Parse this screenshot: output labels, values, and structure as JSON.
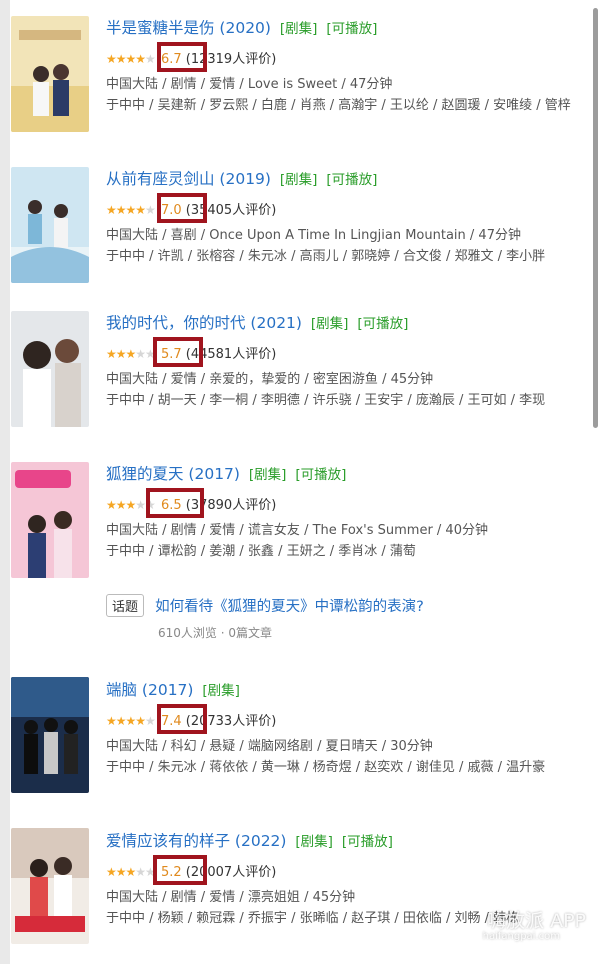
{
  "items": [
    {
      "title": "半是蜜糖半是伤 (2020)",
      "tags": [
        "[剧集]",
        "[可播放]"
      ],
      "stars": 3.5,
      "score": "6.7",
      "reviews": "(12319人评价)",
      "meta": "中国大陆 / 剧情 / 爱情 / Love is Sweet / 47分钟",
      "cast": "于中中 / 吴建新 / 罗云熙 / 白鹿 / 肖燕 / 高瀚宇 / 王以纶 / 赵圆瑗 / 安唯绫 / 管梓"
    },
    {
      "title": "从前有座灵剑山 (2019)",
      "tags": [
        "[剧集]",
        "[可播放]"
      ],
      "stars": 3.5,
      "score": "7.0",
      "reviews": "(35405人评价)",
      "meta": "中国大陆 / 喜剧 / Once Upon A Time In Lingjian Mountain / 47分钟",
      "cast": "于中中 / 许凯 / 张榕容 / 朱元冰 / 高雨儿 / 郭晓婷 / 合文俊 / 郑雅文 / 李小胖"
    },
    {
      "title": "我的时代，你的时代 (2021)",
      "tags": [
        "[剧集]",
        "[可播放]"
      ],
      "stars": 3,
      "score": "5.7",
      "reviews": "(44581人评价)",
      "meta": "中国大陆 / 爱情 / 亲爱的，挚爱的 / 密室困游鱼 / 45分钟",
      "cast": "于中中 / 胡一天 / 李一桐 / 李明德 / 许乐骁 / 王安宇 / 庞瀚辰 / 王可如 / 李现"
    },
    {
      "title": "狐狸的夏天 (2017)",
      "tags": [
        "[剧集]",
        "[可播放]"
      ],
      "stars": 3,
      "score": "6.5",
      "reviews": "(37890人评价)",
      "meta": "中国大陆 / 剧情 / 爱情 / 谎言女友 / The Fox's Summer / 40分钟",
      "cast": "于中中 / 谭松韵 / 姜潮 / 张鑫 / 王妍之 / 季肖冰 / 蒲萄"
    },
    {
      "title": "端脑 (2017)",
      "tags": [
        "[剧集]"
      ],
      "stars": 3.5,
      "score": "7.4",
      "reviews": "(20733人评价)",
      "meta": "中国大陆 / 科幻 / 悬疑 / 端脑网络剧 / 夏日晴天 / 30分钟",
      "cast": "于中中 / 朱元冰 / 蒋依依 / 黄一琳 / 杨奇煜 / 赵奕欢 / 谢佳见 / 戚薇 / 温升豪"
    },
    {
      "title": "爱情应该有的样子 (2022)",
      "tags": [
        "[剧集]",
        "[可播放]"
      ],
      "stars": 2.5,
      "score": "5.2",
      "reviews": "(20007人评价)",
      "meta": "中国大陆 / 剧情 / 爱情 / 漂亮姐姐 / 45分钟",
      "cast": "于中中 / 杨颖 / 赖冠霖 / 乔振宇 / 张晞临 / 赵子琪 / 田依临 / 刘畅 / 韩栋"
    }
  ],
  "topic": {
    "tag": "话题",
    "title": "如何看待《狐狸的夏天》中谭松韵的表演?",
    "stats": "610人浏览 · 0篇文章"
  },
  "watermark": {
    "text": "嗨放派 APP",
    "sub": "haifangpai.com"
  },
  "colors": {
    "title": "#2770c4",
    "tag": "#2a9d2a",
    "score": "#e08a1e",
    "star": "#f5a623",
    "highlight": "#a0141e"
  }
}
